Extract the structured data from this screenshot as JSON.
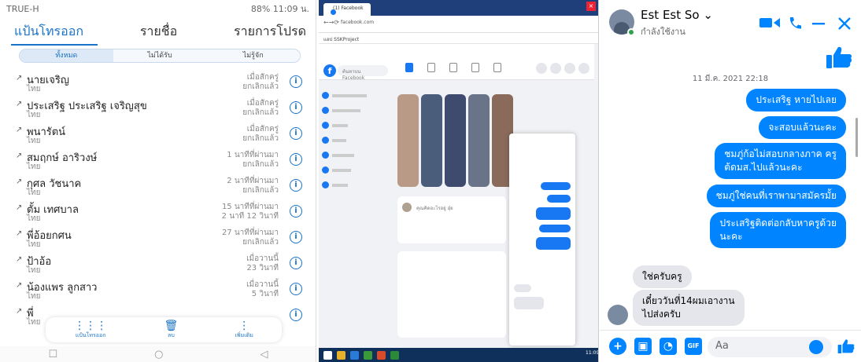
{
  "phone": {
    "carrier": "TRUE-H",
    "status_right": "88% 11:09 น.",
    "tabs": [
      "แป้นโทรออก",
      "รายชื่อ",
      "รายการโปรด"
    ],
    "filter": [
      "ทั้งหมด",
      "ไม่ได้รับ",
      "ไม่รู้จัก"
    ],
    "calls": [
      {
        "name": "นายเจริญ",
        "sub": "ไทย",
        "t1": "เมื่อสักครู่",
        "t2": "ยกเลิกแล้ว"
      },
      {
        "name": "ประเสริฐ ประเสริฐ เจริญสุข",
        "sub": "ไทย",
        "t1": "เมื่อสักครู่",
        "t2": "ยกเลิกแล้ว"
      },
      {
        "name": "พนารัตน์",
        "sub": "ไทย",
        "t1": "เมื่อสักครู่",
        "t2": "ยกเลิกแล้ว"
      },
      {
        "name": "สมฤกษ์ อาริวงษ์",
        "sub": "ไทย",
        "t1": "1 นาทีที่ผ่านมา",
        "t2": "ยกเลิกแล้ว"
      },
      {
        "name": "กุศล วัชนาค",
        "sub": "ไทย",
        "t1": "2 นาทีที่ผ่านมา",
        "t2": "ยกเลิกแล้ว"
      },
      {
        "name": "ตั้ม เทศบาล",
        "sub": "ไทย",
        "t1": "15 นาทีที่ผ่านมา",
        "t2": "2 นาที 12 วินาที"
      },
      {
        "name": "พี่อ้อยกศน",
        "sub": "ไทย",
        "t1": "27 นาทีที่ผ่านมา",
        "t2": "ยกเลิกแล้ว"
      },
      {
        "name": "ป้าอ้อ",
        "sub": "ไทย",
        "t1": "เมื่อวานนี้",
        "t2": "23 วินาที"
      },
      {
        "name": "น้องแพร ลูกสาว",
        "sub": "ไทย",
        "t1": "เมื่อวานนี้",
        "t2": "5 วินาที"
      },
      {
        "name": "พี่",
        "sub": "ไทย",
        "t1": "",
        "t2": ""
      }
    ],
    "bottom_nav": [
      "แป้นโทรออก",
      "ลบ",
      "เพิ่มเติม"
    ],
    "info_glyph": "i"
  },
  "browser": {
    "tab_title": "(1) Facebook",
    "url": "facebook.com",
    "bookmarks": "แอป  SSKProject",
    "search_placeholder": "ค้นหาบน Facebook",
    "composer_placeholder": "คุณคิดอะไรอยู่ อุ๋ย",
    "taskbar_time": "11:09"
  },
  "chat": {
    "name": "Est Est So ⌄",
    "status": "กำลังใช้งาน",
    "timestamp": "11 มี.ค. 2021 22:18",
    "sent": [
      "ประเสริฐ หายไปเลย",
      "จะสอบแล้วนะคะ",
      "ชมภู่ก้อไม่สอบกลางภาค ครู\nต้ดมส.ไปแล้วนะคะ",
      "ชมภู่ใช่คนที่เราพามาสมัครมั้ย",
      "ประเสริฐติดต่อกลับหาครูด้วย\nนะคะ"
    ],
    "received": [
      "ใช่ครับครู",
      "เดี๋ยววันที่14ผมเอางาน\nไปส่งครับ"
    ],
    "composer_placeholder": "Aa",
    "gif_label": "GIF",
    "accent": "#0084ff"
  }
}
